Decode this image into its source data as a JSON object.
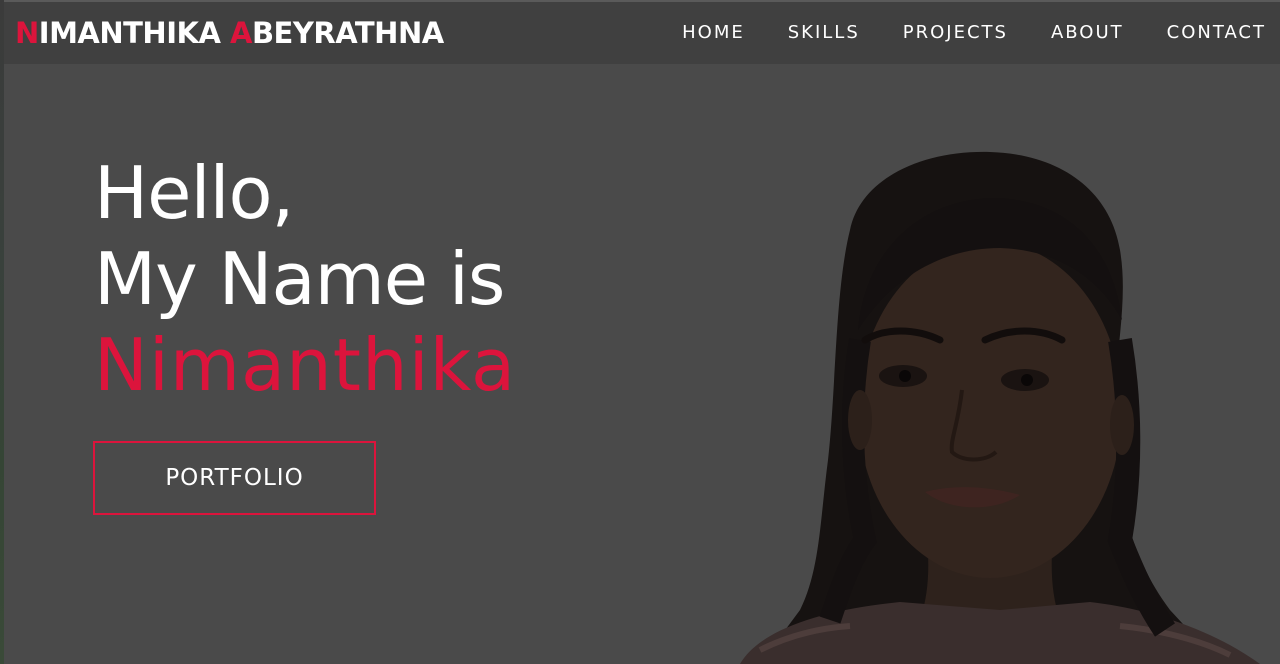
{
  "brand": {
    "first_initial": "N",
    "first_rest": "IMANTHIKA ",
    "last_initial": "A",
    "last_rest": "BEYRATHNA"
  },
  "nav": {
    "items": [
      {
        "label": "HOME"
      },
      {
        "label": "SKILLS"
      },
      {
        "label": "PROJECTS"
      },
      {
        "label": "ABOUT"
      },
      {
        "label": "CONTACT"
      }
    ]
  },
  "hero": {
    "line1": "Hello,",
    "line2": "My Name is",
    "name": "Nimanthika",
    "button_label": "PORTFOLIO"
  },
  "colors": {
    "accent": "#dc143c",
    "navbar": "#404040",
    "background": "#4a4a4a",
    "text": "#ffffff"
  }
}
